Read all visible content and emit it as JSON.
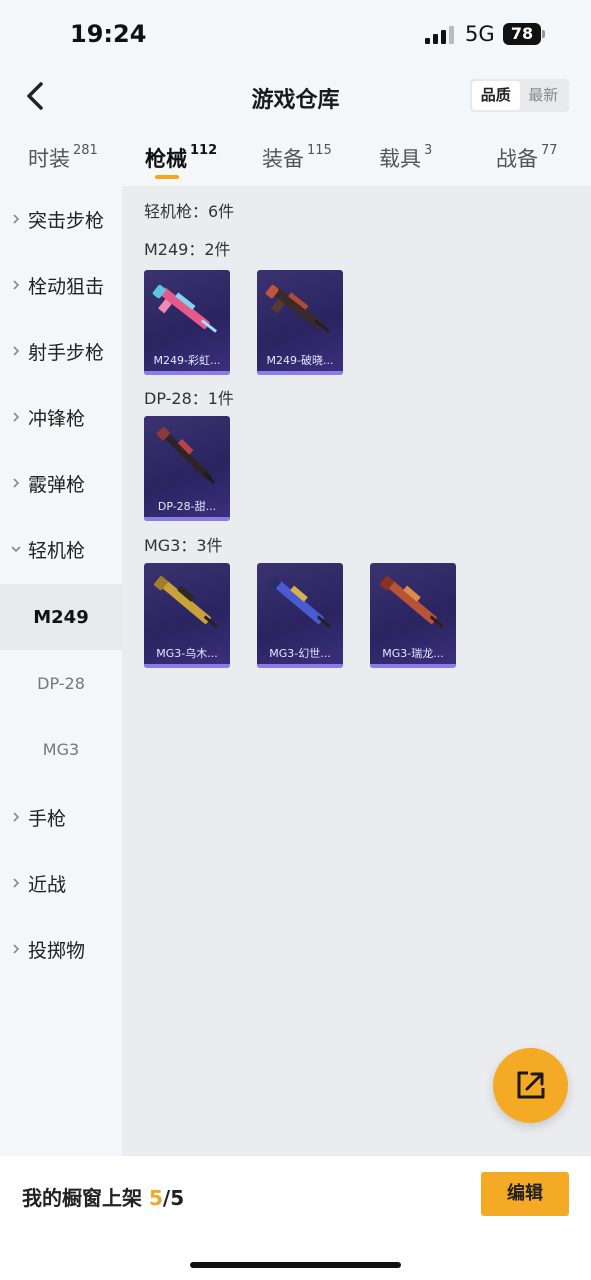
{
  "status": {
    "time": "19:24",
    "network": "5G",
    "battery": "78"
  },
  "header": {
    "title": "游戏仓库",
    "sort": [
      "品质",
      "最新"
    ]
  },
  "tabs": [
    {
      "label": "时装",
      "count": "281"
    },
    {
      "label": "枪械",
      "count": "112"
    },
    {
      "label": "装备",
      "count": "115"
    },
    {
      "label": "载具",
      "count": "3"
    },
    {
      "label": "战备",
      "count": "77"
    }
  ],
  "sidebar": {
    "items": [
      "突击步枪",
      "栓动狙击",
      "射手步枪",
      "冲锋枪",
      "霰弹枪",
      "轻机枪"
    ],
    "sub": [
      "M249",
      "DP-28",
      "MG3"
    ],
    "items_after": [
      "手枪",
      "近战",
      "投掷物"
    ]
  },
  "content": {
    "category_label": "轻机枪：6件",
    "groups": [
      {
        "label": "M249：2件",
        "cards": [
          "M249-彩虹...",
          "M249-破晓..."
        ]
      },
      {
        "label": "DP-28：1件",
        "cards": [
          "DP-28-甜..."
        ]
      },
      {
        "label": "MG3：3件",
        "cards": [
          "MG3-乌木...",
          "MG3-幻世...",
          "MG3-瑞龙..."
        ]
      }
    ]
  },
  "colors": {
    "accent": "#f5a623",
    "card_bg": "#2a2460"
  },
  "bottom": {
    "shelf_label": "我的橱窗上架",
    "shelf_count": "5",
    "shelf_total": "/5",
    "edit_label": "编辑"
  }
}
